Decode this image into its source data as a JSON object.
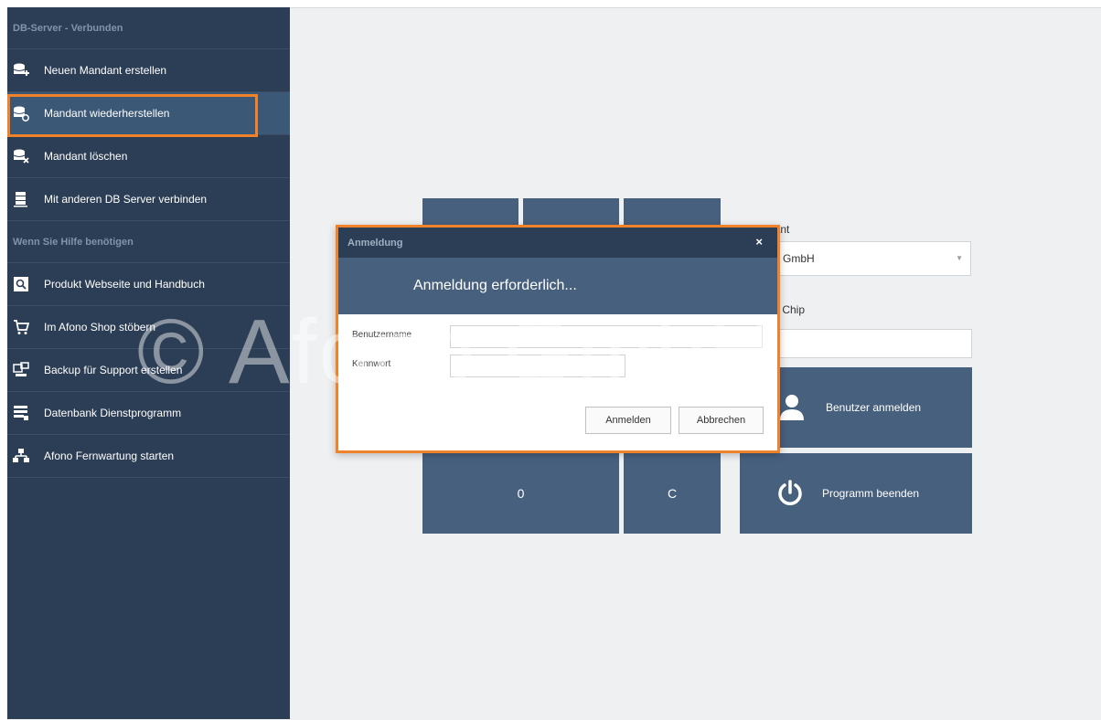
{
  "sidebar": {
    "header_connected": "DB-Server - Verbunden",
    "header_help": "Wenn Sie Hilfe benötigen",
    "items_db": [
      {
        "label": "Neuen Mandant erstellen",
        "icon": "database-add-icon"
      },
      {
        "label": "Mandant wiederherstellen",
        "icon": "database-restore-icon"
      },
      {
        "label": "Mandant löschen",
        "icon": "database-delete-icon"
      },
      {
        "label": "Mit anderen DB Server verbinden",
        "icon": "server-icon"
      }
    ],
    "items_help": [
      {
        "label": "Produkt Webseite und Handbuch",
        "icon": "search-icon"
      },
      {
        "label": "Im Afono Shop stöbern",
        "icon": "cart-icon"
      },
      {
        "label": "Backup für Support erstellen",
        "icon": "backup-icon"
      },
      {
        "label": "Datenbank Dienstprogramm",
        "icon": "database-tool-icon"
      },
      {
        "label": "Afono Fernwartung starten",
        "icon": "network-icon"
      }
    ]
  },
  "main": {
    "mandant_label": "/ Mandant",
    "mandant_value": "GmbH",
    "rfid_label": "er RFID Chip",
    "keypad": {
      "zero": "0",
      "clear": "C"
    },
    "login_button": "Benutzer anmelden",
    "exit_button": "Programm beenden"
  },
  "dialog": {
    "title": "Anmeldung",
    "close": "×",
    "header": "Anmeldung erforderlich...",
    "username_label": "Benutzername",
    "password_label": "Kennwort",
    "ok_button": "Anmelden",
    "cancel_button": "Abbrechen"
  },
  "watermark": "© Afono GmbH",
  "colors": {
    "sidebar_bg": "#2c3e55",
    "tile_bg": "#47607e",
    "highlight": "#f0822a",
    "content_bg": "#eef0f2"
  }
}
